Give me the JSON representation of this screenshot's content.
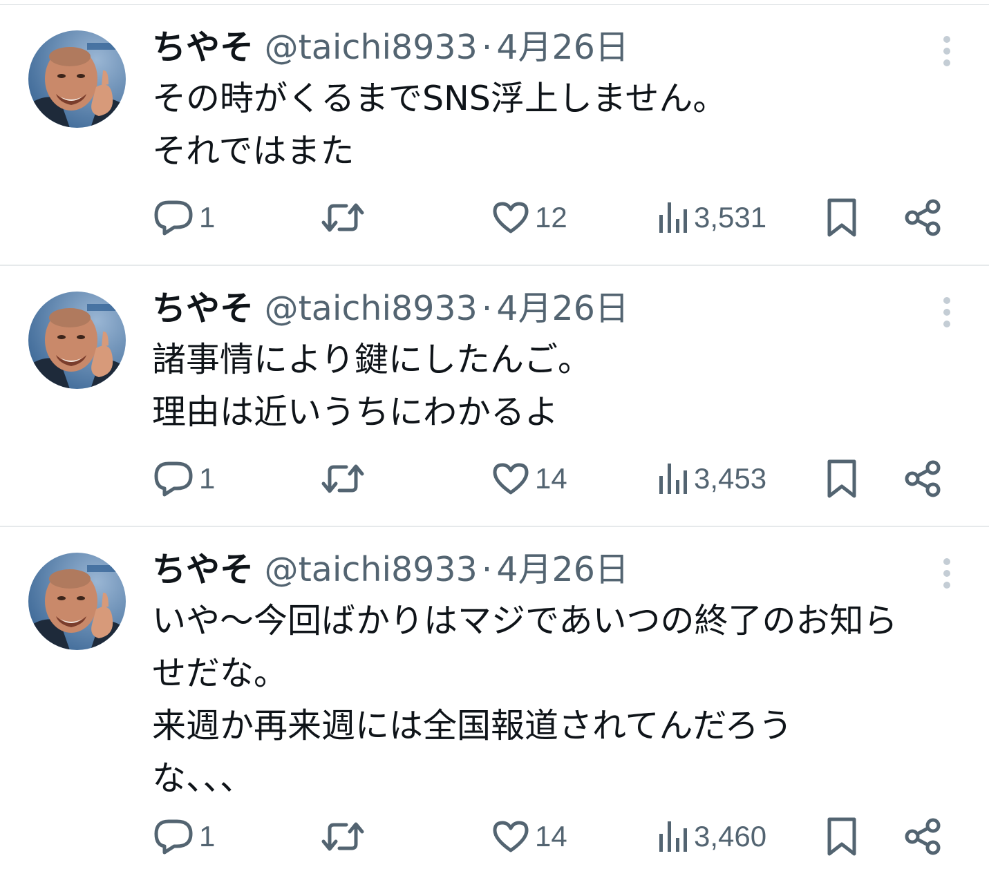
{
  "tweets": [
    {
      "name": "ちやそ",
      "handle": "@taichi8933",
      "separator": "·",
      "date": "4月26日",
      "lines": [
        "その時がくるまでSNS浮上しません。",
        "それではまた"
      ],
      "replies": "1",
      "likes": "12",
      "views": "3,531"
    },
    {
      "name": "ちやそ",
      "handle": "@taichi8933",
      "separator": "·",
      "date": "4月26日",
      "lines": [
        "諸事情により鍵にしたんご。",
        "理由は近いうちにわかるよ"
      ],
      "replies": "1",
      "likes": "14",
      "views": "3,453"
    },
    {
      "name": "ちやそ",
      "handle": "@taichi8933",
      "separator": "·",
      "date": "4月26日",
      "lines": [
        "いや〜今回ばかりはマジであいつの終了のお知ら",
        "せだな。",
        "来週か再来週には全国報道されてんだろう",
        "な、、、"
      ],
      "replies": "1",
      "likes": "14",
      "views": "3,460"
    }
  ],
  "icons": {
    "reply": "speech-bubble-icon",
    "retweet": "retweet-icon",
    "like": "heart-icon",
    "views": "bar-chart-icon",
    "bookmark": "bookmark-icon",
    "share": "share-icon",
    "more": "vertical-ellipsis-icon"
  },
  "colors": {
    "text": "#0f1419",
    "secondary": "#536471",
    "divider": "#e6e9eb",
    "more": "#c4cdd5"
  }
}
